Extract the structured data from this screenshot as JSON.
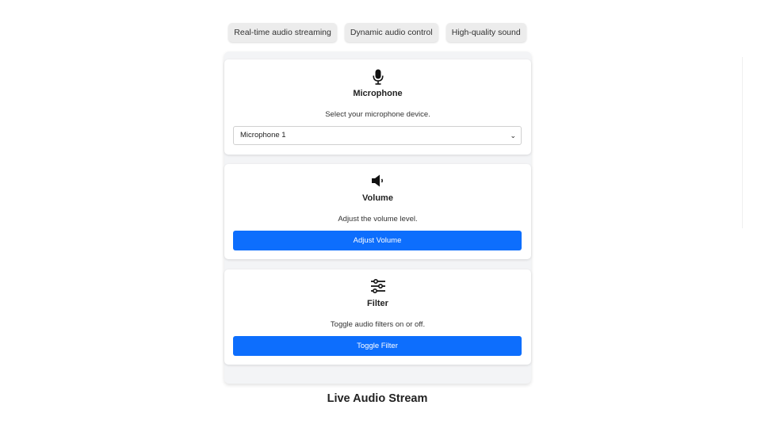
{
  "tags": [
    {
      "label": "Real-time audio streaming"
    },
    {
      "label": "Dynamic audio control"
    },
    {
      "label": "High-quality sound"
    }
  ],
  "cards": {
    "microphone": {
      "icon": "microphone-icon",
      "title": "Microphone",
      "description": "Select your microphone device.",
      "select_value": "Microphone 1"
    },
    "volume": {
      "icon": "speaker-icon",
      "title": "Volume",
      "description": "Adjust the volume level.",
      "button_label": "Adjust Volume"
    },
    "filter": {
      "icon": "sliders-icon",
      "title": "Filter",
      "description": "Toggle audio filters on or off.",
      "button_label": "Toggle Filter"
    }
  },
  "page_title": "Live Audio Stream",
  "colors": {
    "accent": "#0d6efd",
    "panel_bg": "#f3f4f6",
    "tag_bg": "#ececec"
  }
}
